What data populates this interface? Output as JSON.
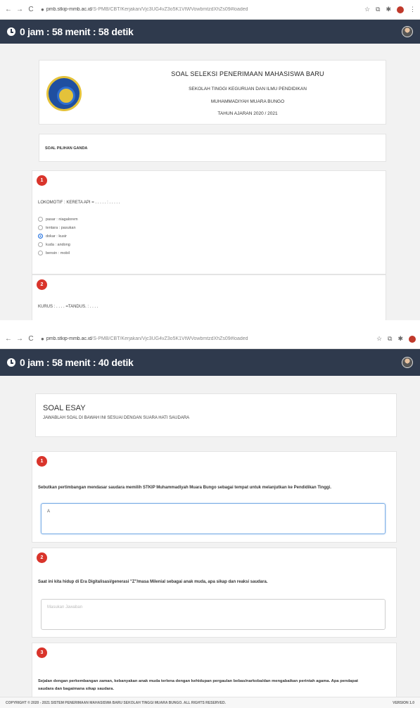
{
  "screen1": {
    "url_host": "pmb.stkip-mmb.ac.id",
    "url_path": "/S-PMB/CBT/Kerjakan/Vjc3UG4vZ3o5K1VtWVowbmtzdXhZs09#loaded",
    "timer": "0 jam : 58 menit : 58 detik",
    "header": {
      "title": "SOAL SELEKSI PENERIMAAN MAHASISWA BARU",
      "line1": "SEKOLAH TINGGI KEGURUAN DAN ILMU PENDIDIKAN",
      "line2": "MUHAMMADIYAH MUARA BUNGO",
      "line3": "TAHUN AJARAN 2020 / 2021"
    },
    "section_title": "SOAL PILIHAN GANDA",
    "questions": [
      {
        "number": "1",
        "text": "LOKOMOTIF : KERETA API = . . . . . : . . . . .",
        "options": [
          "pasar : niagalorem",
          "tentara : pasukan",
          "dokar : kusir",
          "kuda : andong",
          "bensin : mobil"
        ],
        "selected": 2
      },
      {
        "number": "2",
        "text": "KURUS : . . . . =TANDUS. : . . . ."
      }
    ]
  },
  "screen2": {
    "url_host": "pmb.stkip-mmb.ac.id",
    "url_path": "/S-PMB/CBT/Kerjakan/Vjc3UG4vZ3o5K1VtWVowbmtzdXhZs09#loaded",
    "timer": "0 jam : 58 menit : 40 detik",
    "section_title": "SOAL ESAY",
    "section_subtitle": "JAWABLAH SOAL DI BAWAH INI SESUAI DENGAN SUARA HATI SAUDARA",
    "questions": [
      {
        "number": "1",
        "text": "Sebutkan pertimbangan mendasar saudara memilih STKIP Muhammadiyah Muara Bungo sebagai tempat untuk melanjutkan ke Pendidikan Tinggi.",
        "answer": "A"
      },
      {
        "number": "2",
        "text": "Saat ini kita hidup di Era Digitalisasi/generasi \"Z\"/masa Milenial sebagai anak muda, apa sikap dan reaksi saudara.",
        "placeholder": "Masukan Jawaban"
      },
      {
        "number": "3",
        "text_line1": "Sejalan dengan perkembangan zaman, kebanyakan anak muda terlena dengan kehidupan pergaulan bebas/narkoba/dan mengabaikan perintah agama. Apa pendapat",
        "text_line2": "saudara dan bagaimana sikap saudara."
      }
    ],
    "footer_left": "COPYRIGHT © 2020 - 2021 SISTEM PENERIMAAN MAHASISWA BARU SEKOLAH TINGGI MUARA BUNGO. ALL RIGHTS RESERVED.",
    "footer_right": "VERSION 1.0"
  },
  "icons": {
    "back": "←",
    "forward": "→",
    "reload": "C",
    "lock": "🔒",
    "star": "☆",
    "puzzle": "⧉",
    "pin": "✱",
    "menu": "⋮"
  },
  "colors": {
    "timer_bar": "#2f3a4d",
    "badge": "#d9342b",
    "radio_selected": "#1e6fe0"
  }
}
